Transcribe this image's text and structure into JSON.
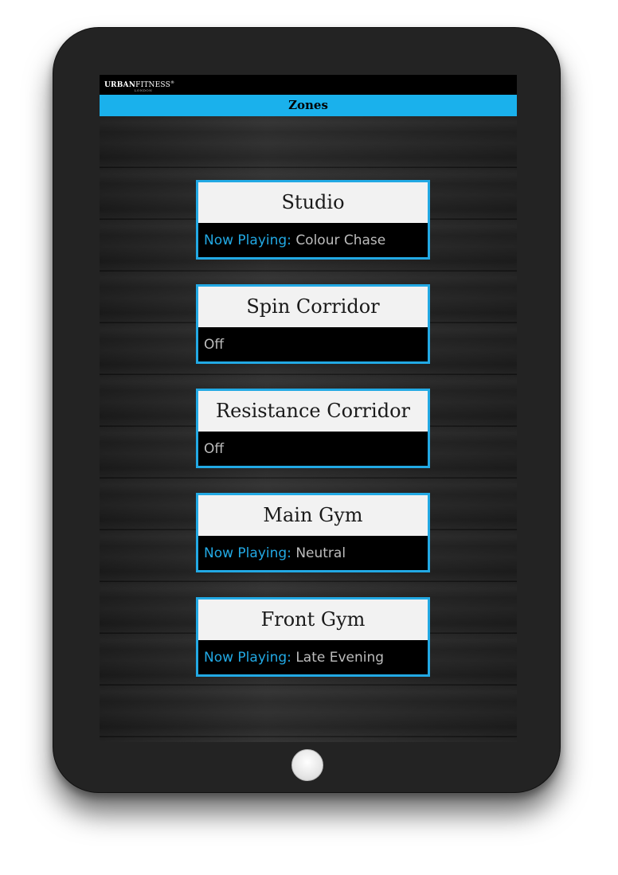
{
  "app": {
    "brand_bold": "URBAN",
    "brand_light": "FITNESS",
    "brand_mark": "®",
    "brand_sub": "LONDON",
    "title": "Zones"
  },
  "colors": {
    "accent": "#1ab1ec",
    "zone_border": "#22a9e4",
    "status_text": "#bdbdbd"
  },
  "zones": [
    {
      "name": "Studio",
      "status_label": "Now Playing:",
      "status_value": "Colour Chase"
    },
    {
      "name": "Spin Corridor",
      "status_label": "",
      "status_value": "Off"
    },
    {
      "name": "Resistance Corridor",
      "status_label": "",
      "status_value": "Off"
    },
    {
      "name": "Main Gym",
      "status_label": "Now Playing:",
      "status_value": "Neutral"
    },
    {
      "name": "Front Gym",
      "status_label": "Now Playing:",
      "status_value": "Late Evening"
    }
  ],
  "device": {
    "home_button_icon": "home-button-icon"
  }
}
